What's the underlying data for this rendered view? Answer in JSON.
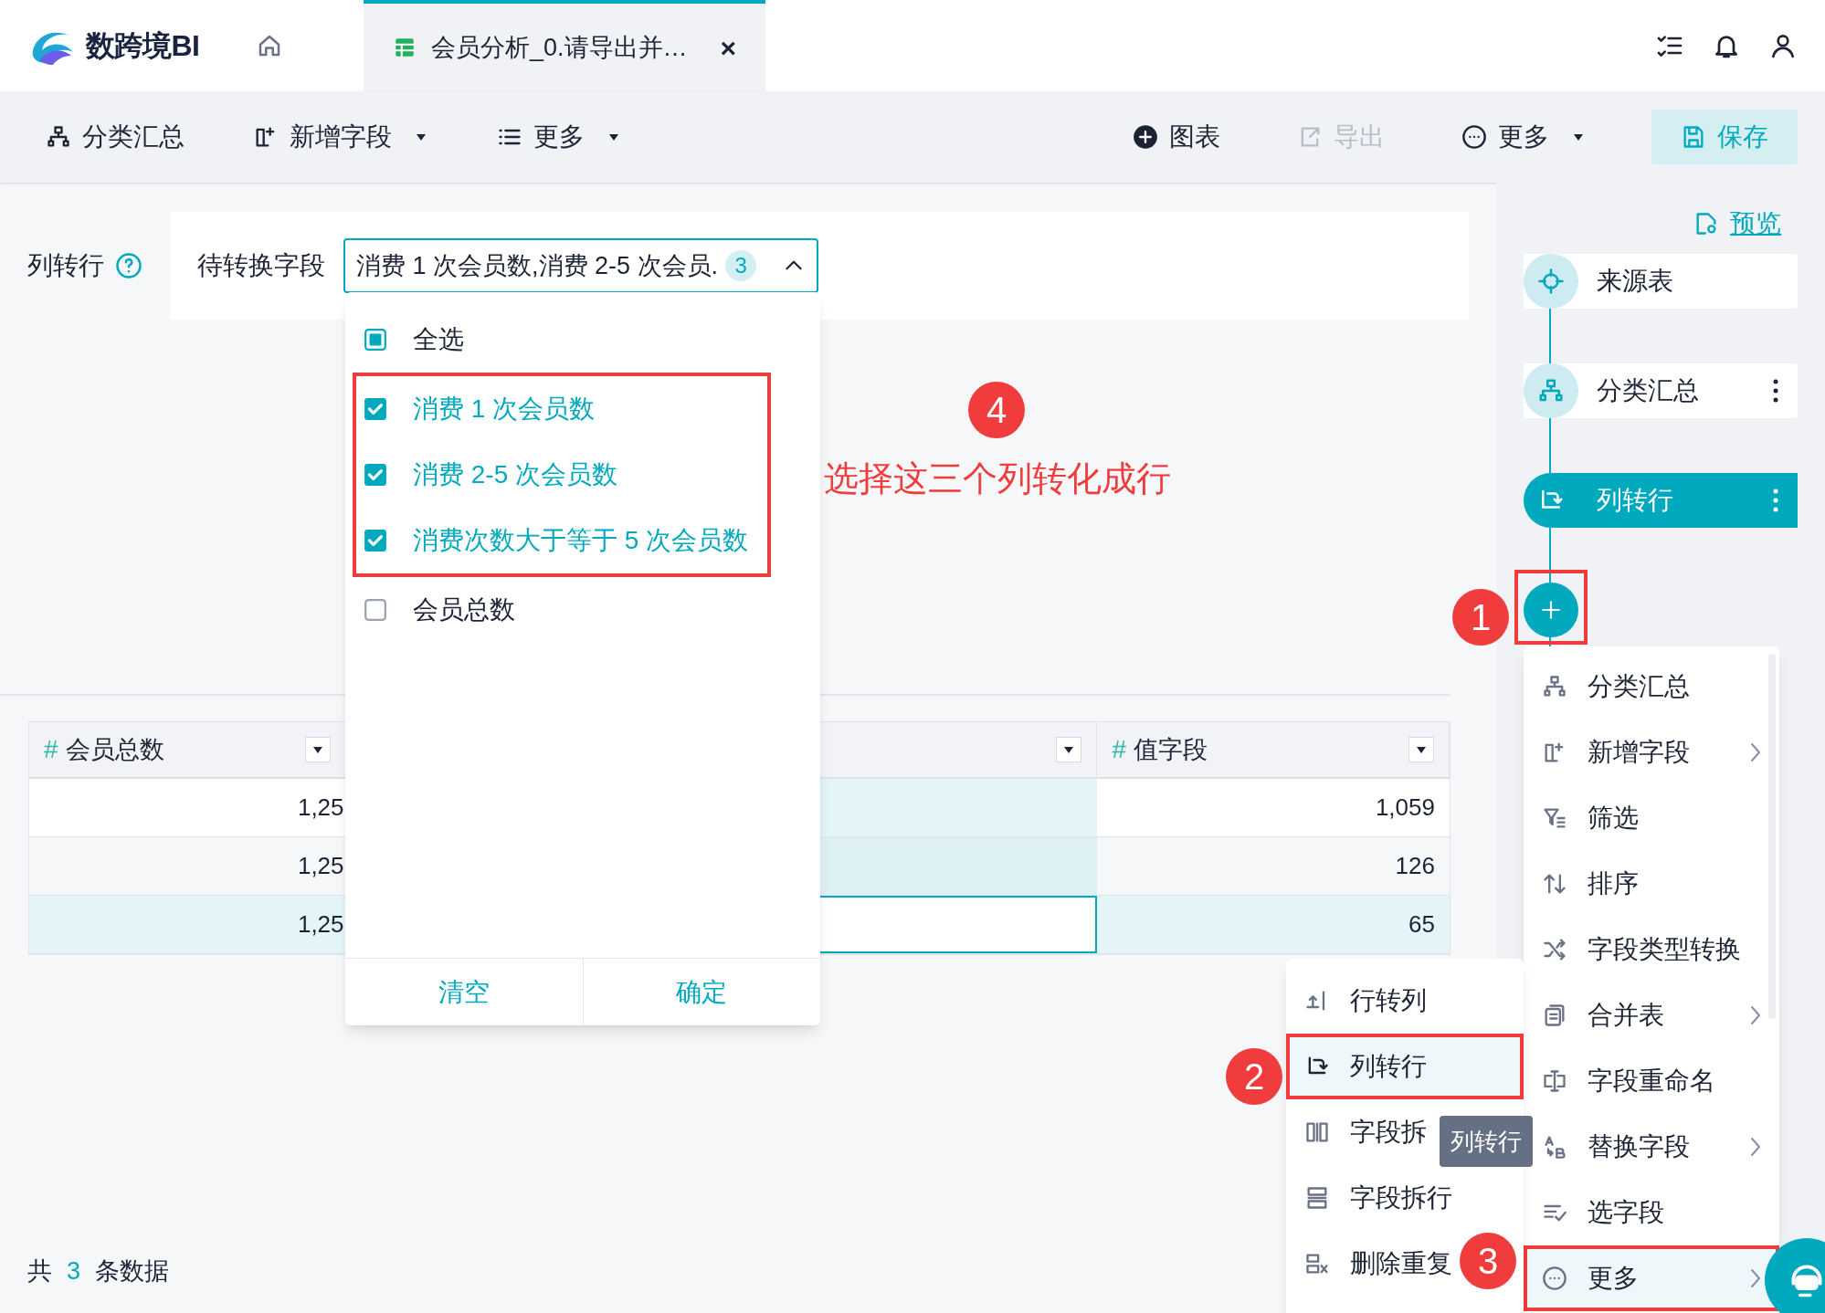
{
  "app": {
    "logo_text": "数跨境BI"
  },
  "tab": {
    "label": "会员分析_0.请导出并…",
    "close": "×",
    "selected": true
  },
  "toolbar_left": [
    {
      "label": "分类汇总",
      "has_caret": false
    },
    {
      "label": "新增字段",
      "has_caret": true
    },
    {
      "label": "更多",
      "has_caret": true
    }
  ],
  "toolbar_right": [
    {
      "kind": "plain",
      "label": "图表",
      "disabled": false,
      "has_caret": false
    },
    {
      "kind": "plain",
      "label": "导出",
      "disabled": true,
      "has_caret": false
    },
    {
      "kind": "plain",
      "label": "更多",
      "disabled": false,
      "has_caret": true
    },
    {
      "kind": "primary",
      "label": "保存",
      "disabled": false,
      "has_caret": false
    }
  ],
  "config": {
    "title": "列转行",
    "field_label": "待转换字段",
    "select_value": "消费 1 次会员数,消费 2-5 次会员.",
    "count": "3",
    "expanded": true
  },
  "dropdown": {
    "select_all": {
      "label": "全选",
      "indeterminate": true
    },
    "options_framed": true,
    "options": [
      {
        "label": "消费 1 次会员数",
        "checked": true
      },
      {
        "label": "消费 2-5 次会员数",
        "checked": true
      },
      {
        "label": "消费次数大于等于 5 次会员数",
        "checked": true
      },
      {
        "label": "会员总数",
        "checked": false
      }
    ],
    "buttons": [
      "清空",
      "确定"
    ]
  },
  "table": {
    "columns": [
      {
        "kind": "named",
        "marker": "#",
        "label": "会员总数"
      },
      {
        "kind": "covered"
      },
      {
        "kind": "named",
        "marker": "#",
        "label": "值字段"
      }
    ],
    "rows": [
      {
        "column_1": "1,25",
        "column_3": "1,059",
        "selected": false
      },
      {
        "column_1": "1,25",
        "column_3": "126",
        "selected": false
      },
      {
        "column_1": "1,25",
        "column_3": "65",
        "selected": true
      }
    ]
  },
  "footer": {
    "prefix": "共",
    "count": "3",
    "suffix": "条数据"
  },
  "preview": "预览",
  "flow": [
    {
      "label": "来源表",
      "selected": false,
      "has_menu": false
    },
    {
      "label": "分类汇总",
      "selected": false,
      "has_menu": true
    },
    {
      "label": "列转行",
      "selected": true,
      "has_menu": true
    }
  ],
  "add_step": {
    "framed": true
  },
  "menu": [
    {
      "label": "分类汇总",
      "has_submenu": false,
      "highlighted": false,
      "framed": false
    },
    {
      "label": "新增字段",
      "has_submenu": true,
      "highlighted": false,
      "framed": false
    },
    {
      "label": "筛选",
      "has_submenu": false,
      "highlighted": false,
      "framed": false
    },
    {
      "label": "排序",
      "has_submenu": false,
      "highlighted": false,
      "framed": false
    },
    {
      "label": "字段类型转换",
      "has_submenu": false,
      "highlighted": false,
      "framed": false
    },
    {
      "label": "合并表",
      "has_submenu": true,
      "highlighted": false,
      "framed": false
    },
    {
      "label": "字段重命名",
      "has_submenu": false,
      "highlighted": false,
      "framed": false
    },
    {
      "label": "替换字段",
      "has_submenu": true,
      "highlighted": false,
      "framed": false
    },
    {
      "label": "选字段",
      "has_submenu": false,
      "highlighted": false,
      "framed": false
    },
    {
      "label": "更多",
      "has_submenu": true,
      "highlighted": true,
      "framed": true
    }
  ],
  "submenu": [
    {
      "label": "行转列",
      "highlighted": false,
      "framed": false
    },
    {
      "label": "列转行",
      "highlighted": true,
      "framed": true
    },
    {
      "label": "字段拆",
      "highlighted": false,
      "framed": false
    },
    {
      "label": "字段拆行",
      "highlighted": false,
      "framed": false
    },
    {
      "label": "删除重复",
      "highlighted": false,
      "framed": false
    }
  ],
  "tooltip": "列转行",
  "annotation_note": "选择这三个列转化成行",
  "step_badges": [
    "1",
    "2",
    "3",
    "4"
  ]
}
